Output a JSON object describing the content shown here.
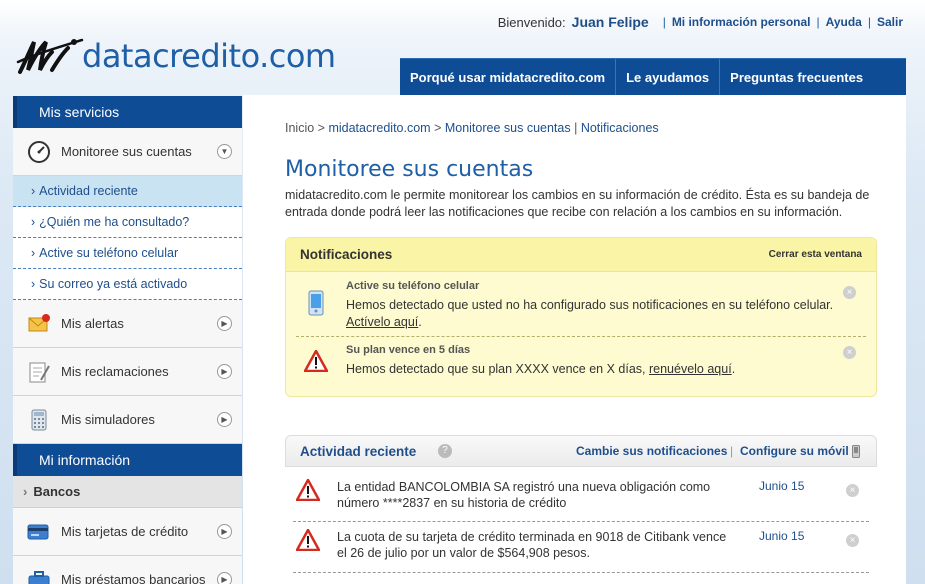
{
  "header": {
    "logo_text": "datacredito.com",
    "welcome": "Bienvenido:",
    "user_name": "Juan Felipe",
    "links": [
      "Mi información personal",
      "Ayuda",
      "Salir"
    ],
    "nav": [
      "Porqué usar midatacredito.com",
      "Le ayudamos",
      "Preguntas frecuentes"
    ]
  },
  "sidebar": {
    "section1": "Mis servicios",
    "monitor": "Monitoree sus cuentas",
    "subitems": [
      "Actividad reciente",
      "¿Quién me ha consultado?",
      "Active su teléfono celular",
      "Su correo ya está activado"
    ],
    "alerts": "Mis alertas",
    "claims": "Mis reclamaciones",
    "simulators": "Mis simuladores",
    "section2": "Mi información",
    "banks": "Bancos",
    "cards": "Mis tarjetas de crédito",
    "loans": "Mis préstamos bancarios"
  },
  "main": {
    "crumb_home": "Inicio",
    "crumb_site": "midatacredito.com",
    "crumb_section": "Monitoree sus cuentas",
    "crumb_page": "Notificaciones",
    "title": "Monitoree sus cuentas",
    "description": "midatacredito.com le permite monitorear los cambios en su información de crédito. Ésta es su bandeja de entrada donde podrá leer las notificaciones que recibe con relación a los cambios en su información."
  },
  "notifications": {
    "title": "Notificaciones",
    "close": "Cerrar esta ventana",
    "items": [
      {
        "title": "Active su teléfono celular",
        "text": "Hemos detectado que usted no ha configurado sus notificaciones en su teléfono celular.",
        "link": "Actívelo aquí",
        "after": "."
      },
      {
        "title": "Su plan vence en 5 días",
        "text": "Hemos detectado que su plan XXXX vence en X días,",
        "link": "renuévelo aquí",
        "after": "."
      }
    ]
  },
  "activity": {
    "title": "Actividad reciente",
    "change_link": "Cambie sus notificaciones",
    "mobile_link": "Configure su móvil",
    "items": [
      {
        "text": "La entidad BANCOLOMBIA SA registró una nueva obligación como número ****2837 en su historia de crédito",
        "date": "Junio 15"
      },
      {
        "text": "La cuota de su tarjeta de crédito terminada en 9018 de Citibank vence el 26 de julio por un valor de $564,908 pesos.",
        "date": "Junio 15"
      }
    ]
  },
  "colors": {
    "brand_blue": "#0f4c96",
    "link_blue": "#1e4f8c",
    "notif_yellow": "#fefbd0"
  }
}
